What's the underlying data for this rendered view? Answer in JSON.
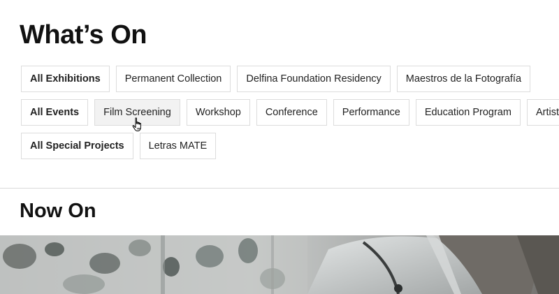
{
  "page_title": "What’s On",
  "filters": {
    "exhibitions": {
      "all_label": "All Exhibitions",
      "items": [
        "Permanent Collection",
        "Delfina Foundation Residency",
        "Maestros de la Fotografía"
      ]
    },
    "events": {
      "all_label": "All Events",
      "items": [
        "Film Screening",
        "Workshop",
        "Conference",
        "Performance",
        "Education Program",
        "Artist Talk"
      ]
    },
    "special_projects": {
      "all_label": "All Special Projects",
      "items": [
        "Letras MATE"
      ]
    }
  },
  "now_on": {
    "title": "Now On",
    "hero_image": "lab-scientist-photo"
  },
  "cursor": "hand-pointer-icon",
  "hovered_filter": "Film Screening"
}
